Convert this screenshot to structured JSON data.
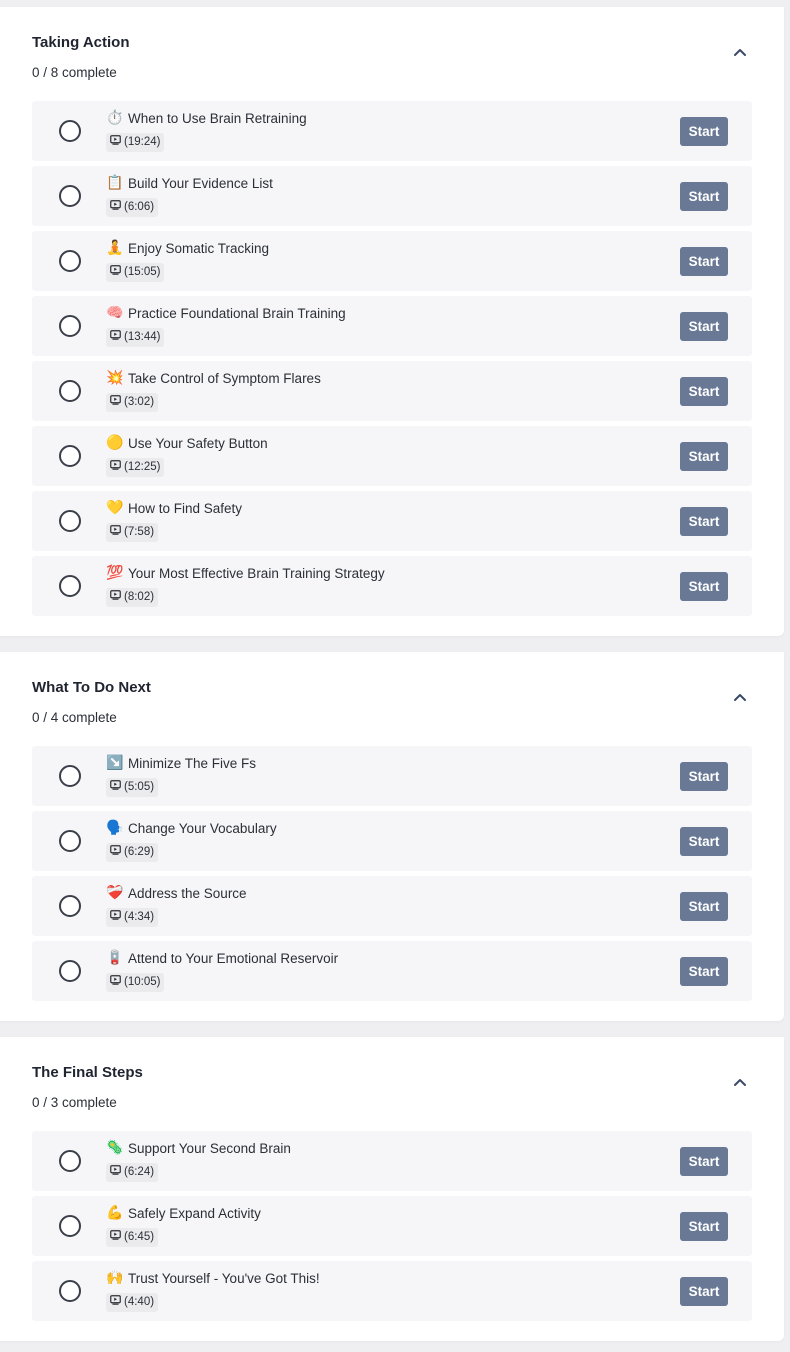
{
  "start_label": "Start",
  "colors": {
    "button": "#687895",
    "row_bg": "#f6f6f8",
    "page_bg": "#efeff1"
  },
  "sections": [
    {
      "title": "Taking Action",
      "progress": "0 / 8 complete",
      "lessons": [
        {
          "emoji": "⏱️",
          "icon": "stopwatch-icon",
          "title": "When to Use Brain Retraining",
          "duration": "(19:24)"
        },
        {
          "emoji": "📋",
          "icon": "clipboard-icon",
          "title": "Build Your Evidence List",
          "duration": "(6:06)"
        },
        {
          "emoji": "🧘",
          "icon": "meditation-icon",
          "title": "Enjoy Somatic Tracking",
          "duration": "(15:05)"
        },
        {
          "emoji": "🧠",
          "icon": "brain-icon",
          "title": "Practice Foundational Brain Training",
          "duration": "(13:44)"
        },
        {
          "emoji": "💥",
          "icon": "explosion-icon",
          "title": "Take Control of Symptom Flares",
          "duration": "(3:02)"
        },
        {
          "emoji": "🟡",
          "icon": "yellow-circle-icon",
          "title": "Use Your Safety Button",
          "duration": "(12:25)"
        },
        {
          "emoji": "💛",
          "icon": "yellow-heart-icon",
          "title": "How to Find Safety",
          "duration": "(7:58)"
        },
        {
          "emoji": "💯",
          "icon": "hundred-points-icon",
          "title": "Your Most Effective Brain Training Strategy",
          "duration": "(8:02)"
        }
      ]
    },
    {
      "title": "What To Do Next",
      "progress": "0 / 4 complete",
      "lessons": [
        {
          "emoji": "↘️",
          "icon": "arrow-down-right-icon",
          "title": "Minimize The Five Fs",
          "duration": "(5:05)"
        },
        {
          "emoji": "🗣️",
          "icon": "speaking-head-icon",
          "title": "Change Your Vocabulary",
          "duration": "(6:29)"
        },
        {
          "emoji": "❤️‍🩹",
          "icon": "mending-heart-icon",
          "title": "Address the Source",
          "duration": "(4:34)"
        },
        {
          "emoji": "🪫",
          "icon": "battery-icon",
          "title": "Attend to Your Emotional Reservoir",
          "duration": "(10:05)"
        }
      ]
    },
    {
      "title": "The Final Steps",
      "progress": "0 / 3 complete",
      "lessons": [
        {
          "emoji": "🦠",
          "icon": "microbe-icon",
          "title": "Support Your Second Brain",
          "duration": "(6:24)"
        },
        {
          "emoji": "💪",
          "icon": "flexed-bicep-icon",
          "title": "Safely Expand Activity",
          "duration": "(6:45)"
        },
        {
          "emoji": "🙌",
          "icon": "raised-hands-icon",
          "title": "Trust Yourself - You've Got This!",
          "duration": "(4:40)"
        }
      ]
    }
  ]
}
